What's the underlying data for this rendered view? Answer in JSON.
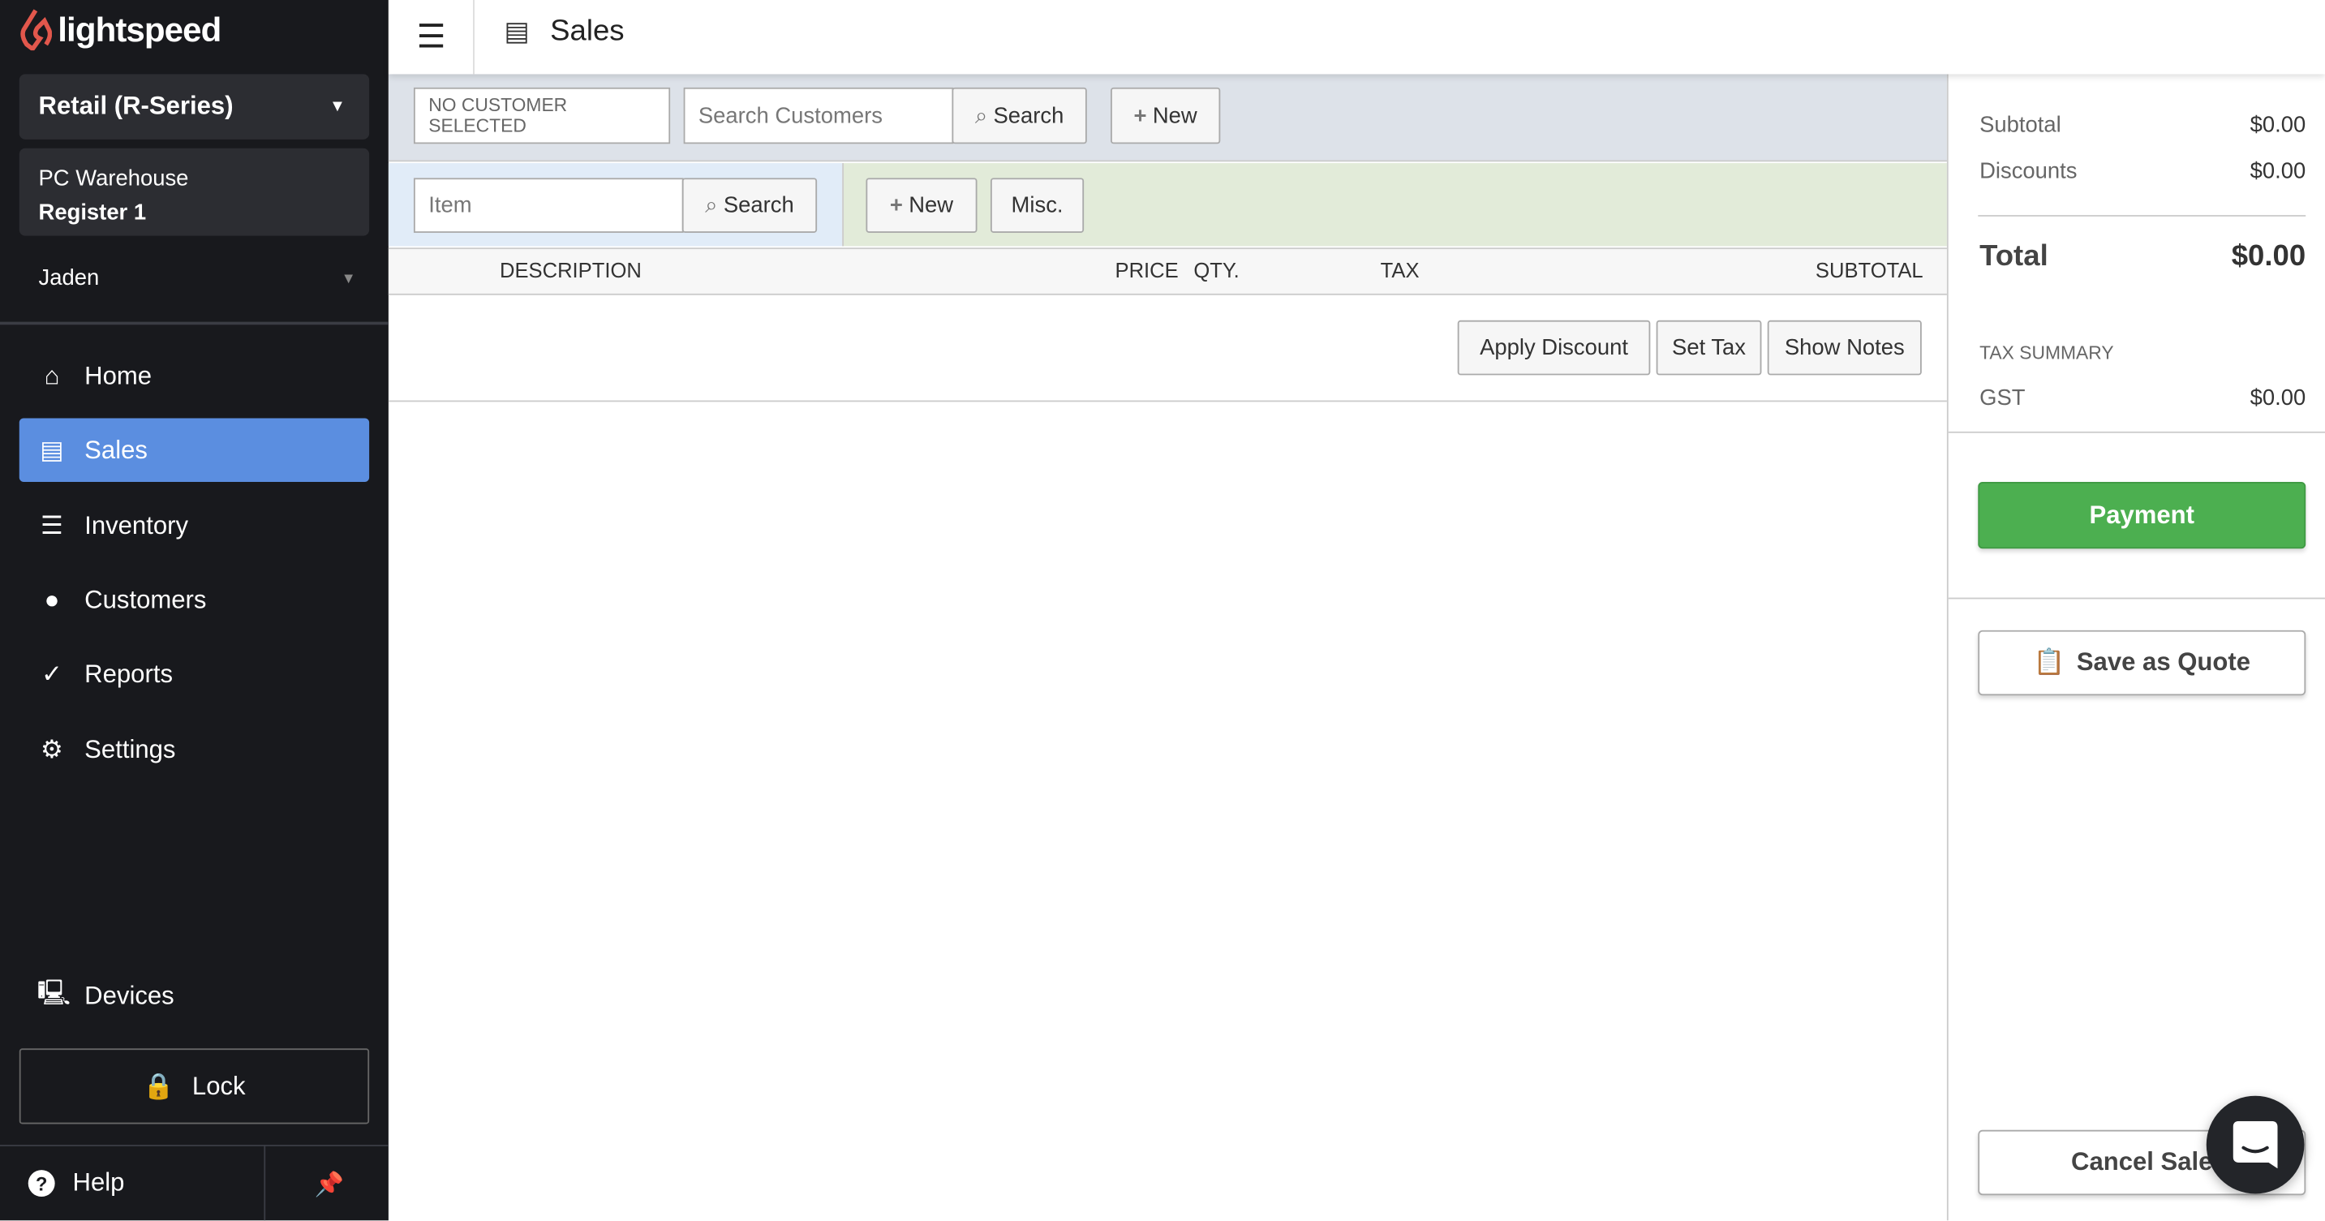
{
  "brand": {
    "name": "lightspeed",
    "color": "#e2574c"
  },
  "sidebar": {
    "product": "Retail (R-Series)",
    "location": "PC Warehouse",
    "register": "Register 1",
    "user": "Jaden",
    "items": [
      {
        "label": "Home",
        "icon": "home-icon"
      },
      {
        "label": "Sales",
        "icon": "cash-register-icon",
        "active": true
      },
      {
        "label": "Inventory",
        "icon": "inventory-icon"
      },
      {
        "label": "Customers",
        "icon": "user-icon"
      },
      {
        "label": "Reports",
        "icon": "chart-icon"
      },
      {
        "label": "Settings",
        "icon": "gear-icon"
      }
    ],
    "devices": "Devices",
    "lock": "Lock",
    "help": "Help",
    "accent": "#5b8ee0"
  },
  "header": {
    "title": "Sales"
  },
  "customer_bar": {
    "no_customer": "NO CUSTOMER SELECTED",
    "search_placeholder": "Search Customers",
    "search": "Search",
    "new": "New"
  },
  "item_bar": {
    "item_placeholder": "Item",
    "search": "Search",
    "new": "New",
    "misc": "Misc."
  },
  "table": {
    "columns": [
      "DESCRIPTION",
      "PRICE",
      "QTY.",
      "TAX",
      "SUBTOTAL"
    ]
  },
  "actions": {
    "apply_discount": "Apply Discount",
    "set_tax": "Set Tax",
    "show_notes": "Show Notes"
  },
  "summary": {
    "subtotal_label": "Subtotal",
    "subtotal": "$0.00",
    "discounts_label": "Discounts",
    "discounts": "$0.00",
    "total_label": "Total",
    "total": "$0.00",
    "tax_summary": "TAX SUMMARY",
    "gst_label": "GST",
    "gst": "$0.00",
    "payment": "Payment",
    "save_quote": "Save as Quote",
    "cancel_sale": "Cancel Sale",
    "payment_color": "#4caf50"
  }
}
